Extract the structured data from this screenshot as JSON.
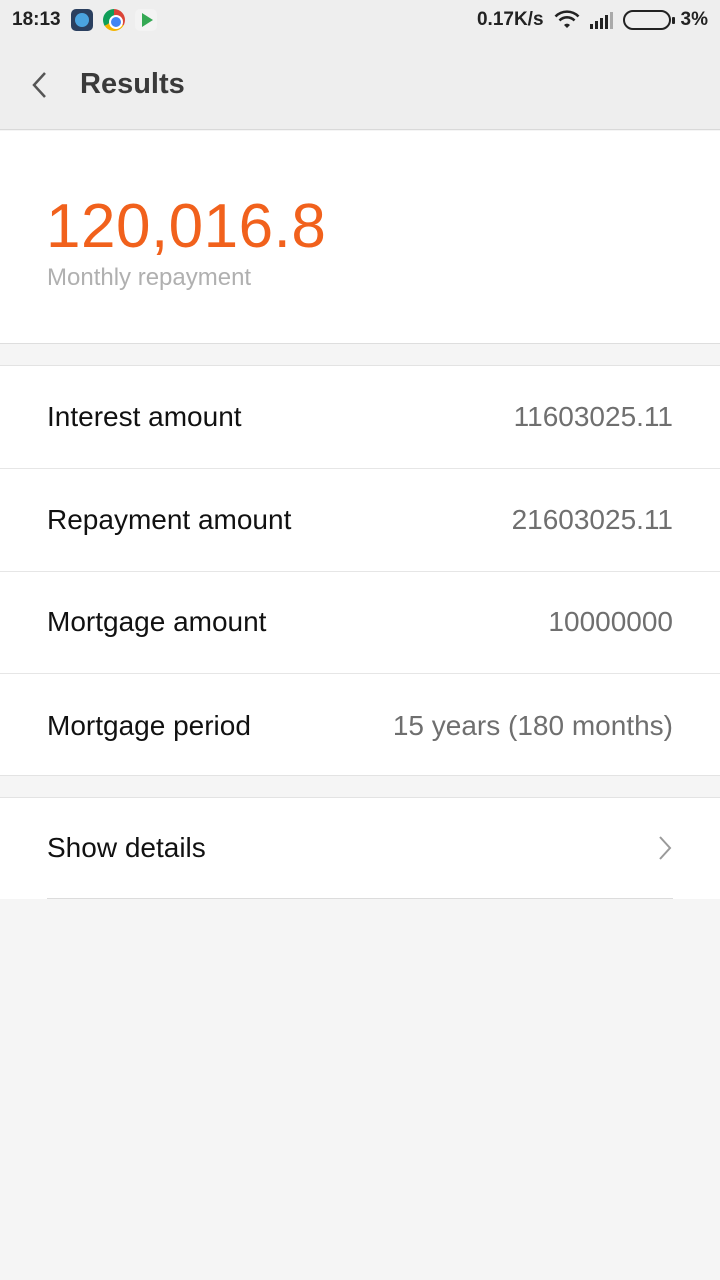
{
  "status_bar": {
    "time": "18:13",
    "notification_icons": [
      "telegram-icon",
      "chrome-icon",
      "play-store-icon"
    ],
    "network_speed": "0.17K/s",
    "battery_percent": "3%"
  },
  "app_bar": {
    "title": "Results",
    "back_icon": "chevron-left-icon"
  },
  "summary": {
    "amount": "120,016.8",
    "label": "Monthly repayment",
    "accent_color": "#f1611c"
  },
  "details": [
    {
      "label": "Interest amount",
      "value": "11603025.11"
    },
    {
      "label": "Repayment amount",
      "value": "21603025.11"
    },
    {
      "label": "Mortgage amount",
      "value": "10000000"
    },
    {
      "label": "Mortgage period",
      "value": "15 years (180 months)"
    }
  ],
  "show_details": {
    "label": "Show details",
    "icon": "chevron-right-icon"
  }
}
